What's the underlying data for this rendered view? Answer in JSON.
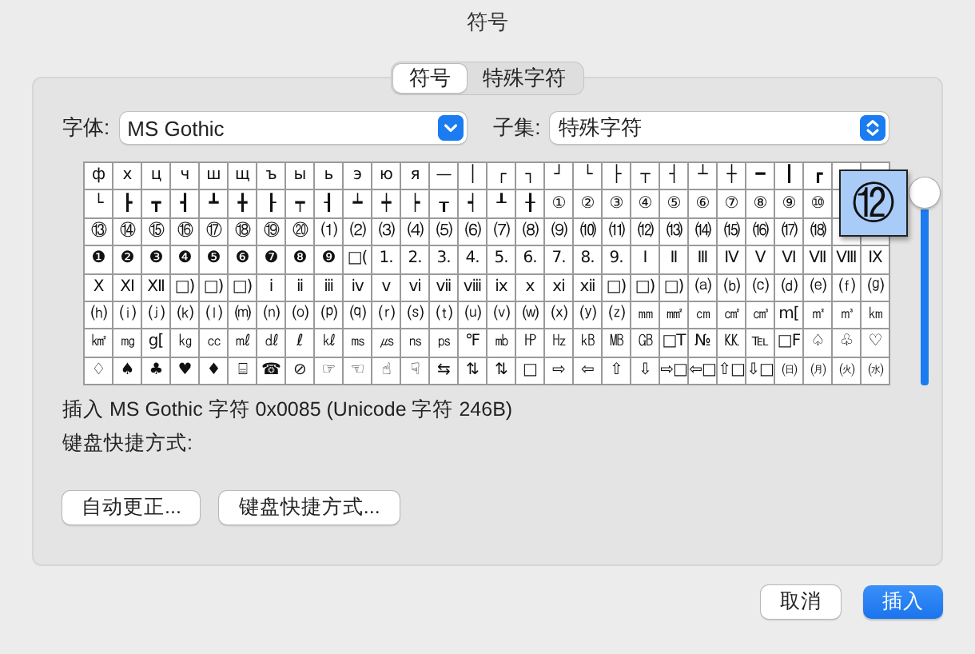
{
  "window": {
    "title": "符号"
  },
  "tabs": [
    {
      "label": "符号",
      "selected": true
    },
    {
      "label": "特殊字符",
      "selected": false
    }
  ],
  "font": {
    "label": "字体:",
    "value": "MS Gothic"
  },
  "subset": {
    "label": "子集:",
    "value": "特殊字符"
  },
  "grid": {
    "rows": [
      [
        "ф",
        "х",
        "ц",
        "ч",
        "ш",
        "щ",
        "ъ",
        "ы",
        "ь",
        "э",
        "ю",
        "я",
        "—",
        "│",
        "┌",
        "┐",
        "┘",
        "└",
        "├",
        "┬",
        "┤",
        "┴",
        "┼",
        "━",
        "┃",
        "┏"
      ],
      [
        "└",
        "┣",
        "┳",
        "┫",
        "┻",
        "╋",
        "┠",
        "┯",
        "┨",
        "┷",
        "┿",
        "┝",
        "┰",
        "┥",
        "┸",
        "╂",
        "①",
        "②",
        "③",
        "④",
        "⑤",
        "⑥",
        "⑦",
        "⑧",
        "⑨",
        "⑩"
      ],
      [
        "⑬",
        "⑭",
        "⑮",
        "⑯",
        "⑰",
        "⑱",
        "⑲",
        "⑳",
        "⑴",
        "⑵",
        "⑶",
        "⑷",
        "⑸",
        "⑹",
        "⑺",
        "⑻",
        "⑼",
        "⑽",
        "⑾",
        "⑿",
        "⒀",
        "⒁",
        "⒂",
        "⒃",
        "⒄",
        "⒅"
      ],
      [
        "❶",
        "❷",
        "❸",
        "❹",
        "❺",
        "❻",
        "❼",
        "❽",
        "❾",
        "□(",
        "1.",
        "2.",
        "3.",
        "4.",
        "5.",
        "6.",
        "7.",
        "8.",
        "9.",
        "Ⅰ",
        "Ⅱ",
        "Ⅲ",
        "Ⅳ",
        "Ⅴ",
        "Ⅵ",
        "Ⅶ",
        "Ⅷ",
        "Ⅸ"
      ],
      [
        "Ⅹ",
        "Ⅺ",
        "Ⅻ",
        "□)",
        "□)",
        "□)",
        "ⅰ",
        "ⅱ",
        "ⅲ",
        "ⅳ",
        "ⅴ",
        "ⅵ",
        "ⅶ",
        "ⅷ",
        "ⅸ",
        "ⅹ",
        "ⅺ",
        "ⅻ",
        "□)",
        "□)",
        "□)",
        "⒜",
        "⒝",
        "⒞",
        "⒟",
        "⒠",
        "⒡",
        "⒢"
      ],
      [
        "⒣",
        "⒤",
        "⒥",
        "⒦",
        "⒧",
        "⒨",
        "⒩",
        "⒪",
        "⒫",
        "⒬",
        "⒭",
        "⒮",
        "⒯",
        "⒰",
        "⒱",
        "⒲",
        "⒳",
        "⒴",
        "⒵",
        "㎜",
        "㎟",
        "㎝",
        "㎠",
        "㎤",
        "m[",
        "㎡",
        "㎥",
        "㎞"
      ],
      [
        "㎢",
        "㎎",
        "g[",
        "㎏",
        "㏄",
        "㎖",
        "㎗",
        "ℓ",
        "㎘",
        "㎳",
        "㎲",
        "㎱",
        "㎰",
        "℉",
        "㏔",
        "㏋",
        "㎐",
        "㎅",
        "㎆",
        "㎇",
        "□T",
        "№",
        "㏍",
        "℡",
        "□F",
        "♤",
        "♧",
        "♡"
      ],
      [
        "♢",
        "♠",
        "♣",
        "♥",
        "♦",
        "⌸",
        "☎",
        "⊘",
        "☞",
        "☜",
        "☝",
        "☟",
        "⇆",
        "⇅",
        "⇅",
        "□",
        "⇨",
        "⇦",
        "⇧",
        "⇩",
        "⇨□",
        "⇦□",
        "⇧□",
        "⇩□",
        "㈰",
        "㈪",
        "㈫",
        "㈬"
      ]
    ],
    "magnified": "⑫"
  },
  "info": "插入 MS Gothic 字符 0x0085 (Unicode 字符 246B)",
  "shortcut_label": "键盘快捷方式:",
  "panel_buttons": [
    "自动更正...",
    "键盘快捷方式..."
  ],
  "buttons": [
    {
      "label": "取消",
      "kind": "secondary"
    },
    {
      "label": "插入",
      "kind": "default"
    }
  ]
}
